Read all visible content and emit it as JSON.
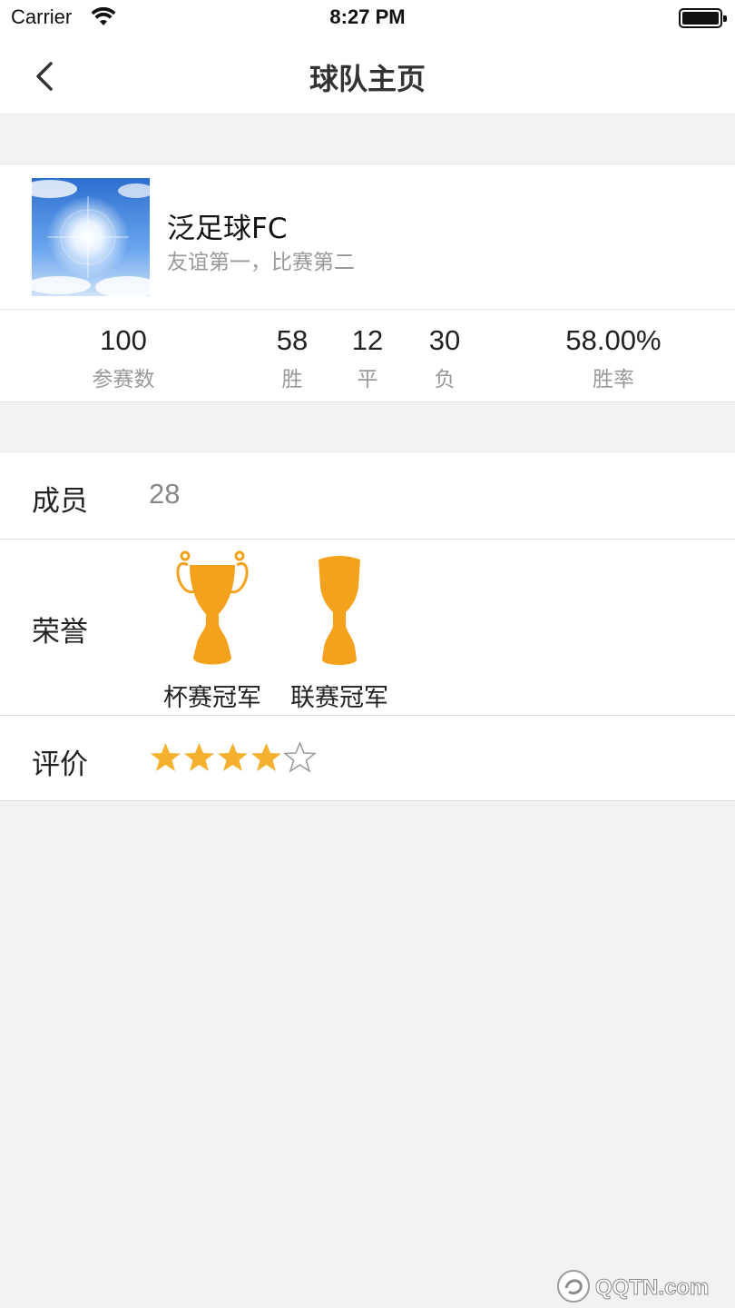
{
  "status_bar": {
    "carrier": "Carrier",
    "time": "8:27 PM"
  },
  "nav": {
    "title": "球队主页",
    "back_icon": "chevron-left-icon"
  },
  "team": {
    "name": "泛足球FC",
    "slogan": "友谊第一，比赛第二",
    "stats": [
      {
        "value": "100",
        "label": "参赛数"
      },
      {
        "value": "58",
        "label": "胜"
      },
      {
        "value": "12",
        "label": "平"
      },
      {
        "value": "30",
        "label": "负"
      },
      {
        "value": "58.00%",
        "label": "胜率"
      }
    ]
  },
  "members": {
    "label": "成员",
    "value": "28"
  },
  "honors": {
    "label": "荣誉",
    "items": [
      {
        "caption": "杯赛冠军",
        "icon": "cup-trophy-icon"
      },
      {
        "caption": "联赛冠军",
        "icon": "league-trophy-icon"
      }
    ]
  },
  "rating": {
    "label": "评价",
    "stars": 4,
    "max": 5
  },
  "colors": {
    "accent": "#f4a21c",
    "star": "#f5b12e",
    "background": "#f2f2f2"
  },
  "watermark": "QQTN.com"
}
